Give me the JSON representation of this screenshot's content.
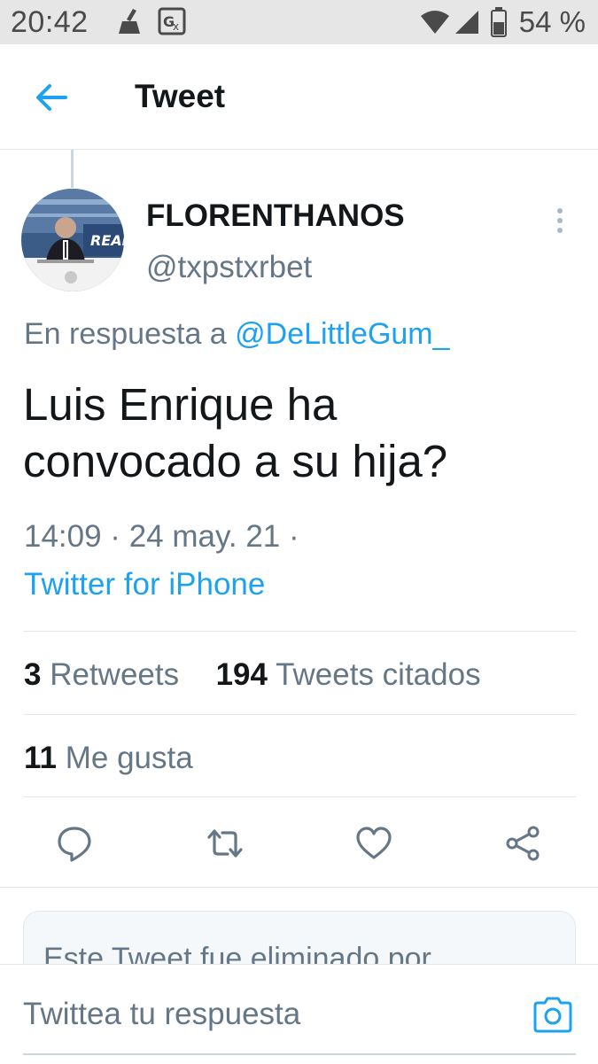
{
  "status_bar": {
    "time": "20:42",
    "battery": "54 %",
    "icons": [
      "cleaning-icon",
      "translate-icon",
      "wifi-icon",
      "signal-icon",
      "battery-icon"
    ]
  },
  "header": {
    "title": "Tweet",
    "back_icon": "arrow-left-icon"
  },
  "tweet": {
    "author_name": "FLORENTHANOS",
    "author_handle": "@txpstxrbet",
    "reply_prefix": "En respuesta a",
    "reply_mention": "@DeLittleGum_",
    "text_line1": "Luis Enrique ha",
    "text_line2": "convocado a su hija?",
    "timestamp": "14:09 · 24 may. 21 ·",
    "source": "Twitter for iPhone"
  },
  "stats": {
    "retweets_count": "3",
    "retweets_label": "Retweets",
    "quotes_count": "194",
    "quotes_label": "Tweets citados",
    "likes_count": "11",
    "likes_label": "Me gusta"
  },
  "actions": [
    "reply-icon",
    "retweet-icon",
    "like-icon",
    "share-icon"
  ],
  "deleted_notice": "Este Tweet fue eliminado por",
  "reply_bar": {
    "placeholder": "Twittea tu respuesta",
    "camera_icon": "camera-icon"
  },
  "colors": {
    "accent": "#1da1f2",
    "text_primary": "#14171a",
    "text_secondary": "#657786",
    "divider": "#e1e8ed",
    "status_bar_bg": "#e6e6e6"
  }
}
